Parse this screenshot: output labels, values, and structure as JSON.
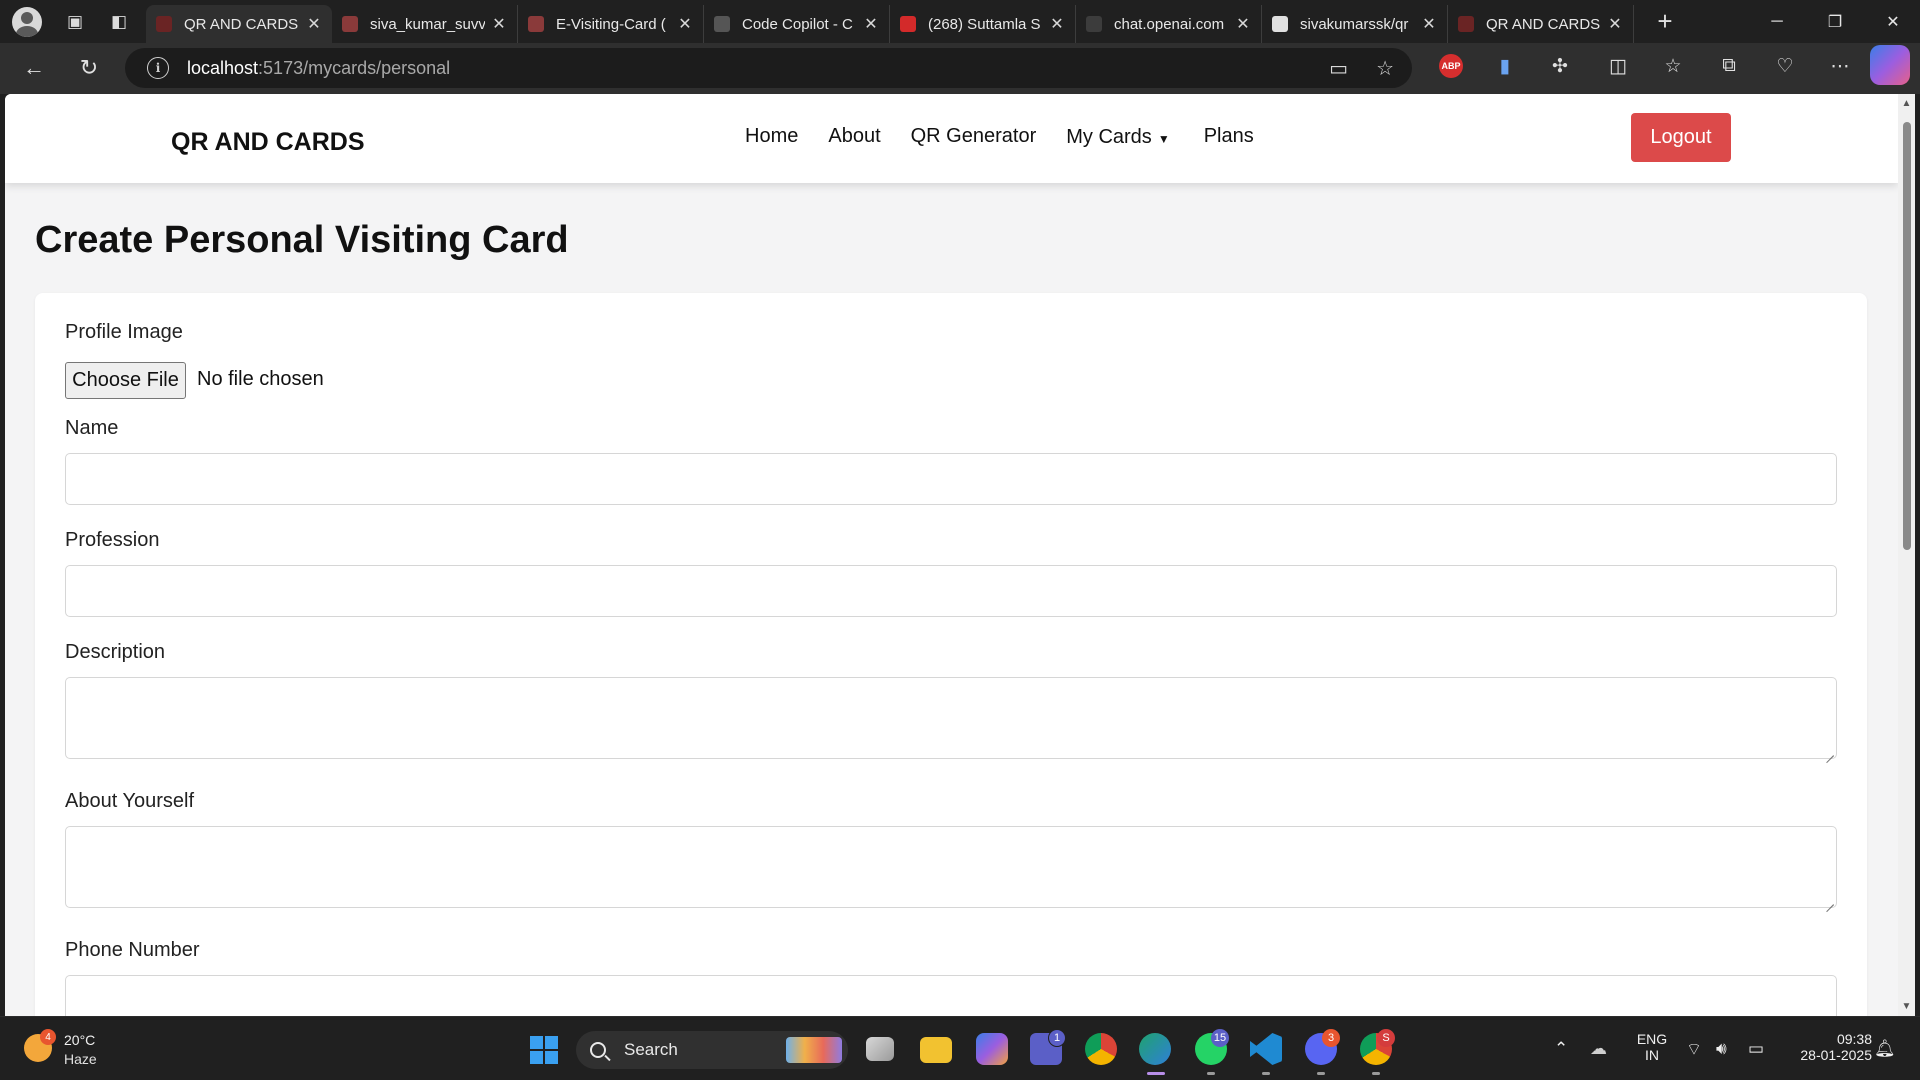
{
  "browser": {
    "tabs": [
      {
        "title": "QR AND CARDS",
        "active": true,
        "favicon_color": "#6a2424"
      },
      {
        "title": "siva_kumar_suvv",
        "active": false,
        "favicon_color": "#8a3a3a"
      },
      {
        "title": "E-Visiting-Card (",
        "active": false,
        "favicon_color": "#8a3a3a"
      },
      {
        "title": "Code Copilot - C",
        "active": false,
        "favicon_color": "#555555"
      },
      {
        "title": "(268) Suttamla S",
        "active": false,
        "favicon_color": "#d32a2a"
      },
      {
        "title": "chat.openai.com",
        "active": false,
        "favicon_color": "#3c3c3c"
      },
      {
        "title": "sivakumarssk/qr",
        "active": false,
        "favicon_color": "#e0e0e0"
      },
      {
        "title": "QR AND CARDS",
        "active": false,
        "favicon_color": "#6a2424"
      }
    ],
    "address": {
      "host": "localhost",
      "path": ":5173/mycards/personal"
    },
    "extensions": {
      "abp_label": "ABP"
    }
  },
  "site": {
    "brand": "QR AND CARDS",
    "nav": {
      "home": "Home",
      "about": "About",
      "qr_generator": "QR Generator",
      "my_cards": "My Cards",
      "plans": "Plans"
    },
    "logout_label": "Logout",
    "accent_color": "#dc4a4a"
  },
  "form": {
    "title": "Create Personal Visiting Card",
    "profile_image_label": "Profile Image",
    "choose_file_label": "Choose File",
    "file_status": "No file chosen",
    "name_label": "Name",
    "name_value": "",
    "profession_label": "Profession",
    "profession_value": "",
    "description_label": "Description",
    "description_value": "",
    "about_label": "About Yourself",
    "about_value": "",
    "phone_label": "Phone Number",
    "phone_value": ""
  },
  "taskbar": {
    "weather_temp": "20°C",
    "weather_desc": "Haze",
    "weather_badge": "4",
    "search_label": "Search",
    "teams_badge": "1",
    "whatsapp_badge": "15",
    "discord_badge": "3",
    "chrome2_badge": "S",
    "lang_line1": "ENG",
    "lang_line2": "IN",
    "time": "09:38",
    "date": "28-01-2025"
  }
}
